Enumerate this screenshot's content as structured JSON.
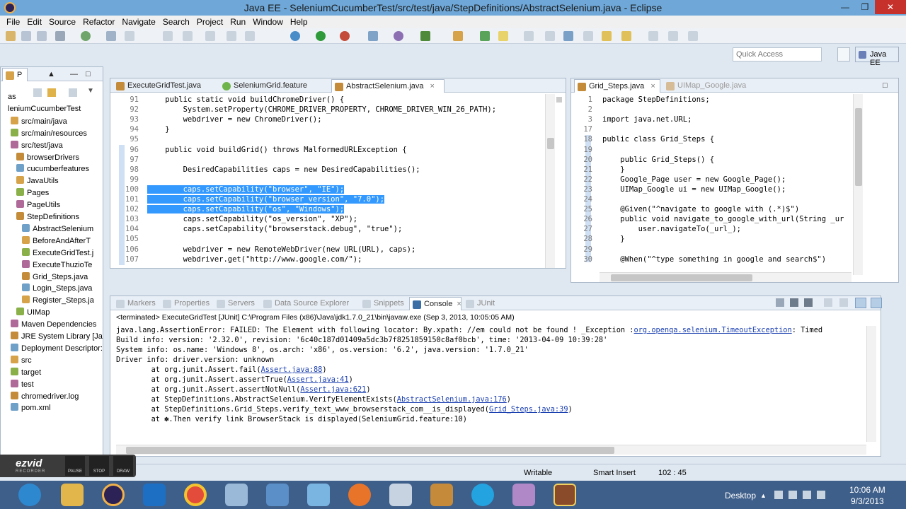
{
  "window": {
    "title": "Java EE - SeleniumCucumberTest/src/test/java/StepDefinitions/AbstractSelenium.java - Eclipse"
  },
  "menu": [
    "File",
    "Edit",
    "Source",
    "Refactor",
    "Navigate",
    "Search",
    "Project",
    "Run",
    "Window",
    "Help"
  ],
  "quick_access": {
    "placeholder": "Quick Access"
  },
  "perspective": {
    "label": "Java EE"
  },
  "package_explorer": {
    "tab_label": "P",
    "items": [
      {
        "label": "as",
        "indent": 0
      },
      {
        "label": "leniumCucumberTest",
        "indent": 0
      },
      {
        "label": "src/main/java",
        "indent": 1
      },
      {
        "label": "src/main/resources",
        "indent": 1
      },
      {
        "label": "src/test/java",
        "indent": 1
      },
      {
        "label": "browserDrivers",
        "indent": 2
      },
      {
        "label": "cucumberfeatures",
        "indent": 2
      },
      {
        "label": "JavaUtils",
        "indent": 2
      },
      {
        "label": "Pages",
        "indent": 2
      },
      {
        "label": "PageUtils",
        "indent": 2
      },
      {
        "label": "StepDefinitions",
        "indent": 2
      },
      {
        "label": "AbstractSelenium",
        "indent": 3
      },
      {
        "label": "BeforeAndAfterT",
        "indent": 3
      },
      {
        "label": "ExecuteGridTest.j",
        "indent": 3
      },
      {
        "label": "ExecuteThuzioTe",
        "indent": 3
      },
      {
        "label": "Grid_Steps.java",
        "indent": 3
      },
      {
        "label": "Login_Steps.java",
        "indent": 3
      },
      {
        "label": "Register_Steps.ja",
        "indent": 3
      },
      {
        "label": "UIMap",
        "indent": 2
      },
      {
        "label": "Maven Dependencies",
        "indent": 1
      },
      {
        "label": "JRE System Library [JavaS",
        "indent": 1
      },
      {
        "label": "Deployment Descriptor:",
        "indent": 1
      },
      {
        "label": "src",
        "indent": 1
      },
      {
        "label": "target",
        "indent": 1
      },
      {
        "label": "test",
        "indent": 1
      },
      {
        "label": "chromedriver.log",
        "indent": 1
      },
      {
        "label": "pom.xml",
        "indent": 1
      }
    ]
  },
  "editor_left": {
    "tabs": [
      {
        "label": "ExecuteGridTest.java",
        "active": false
      },
      {
        "label": "SeleniumGrid.feature",
        "active": false
      },
      {
        "label": "AbstractSelenium.java",
        "active": true
      }
    ],
    "lines": [
      {
        "n": "91",
        "text": "    public static void buildChromeDriver() {"
      },
      {
        "n": "92",
        "text": "        System.setProperty(CHROME_DRIVER_PROPERTY, CHROME_DRIVER_WIN_26_PATH);"
      },
      {
        "n": "93",
        "text": "        webdriver = new ChromeDriver();"
      },
      {
        "n": "94",
        "text": "    }"
      },
      {
        "n": "95",
        "text": ""
      },
      {
        "n": "96",
        "text": "    public void buildGrid() throws MalformedURLException {"
      },
      {
        "n": "97",
        "text": ""
      },
      {
        "n": "98",
        "text": "        DesiredCapabilities caps = new DesiredCapabilities();"
      },
      {
        "n": "99",
        "text": ""
      },
      {
        "n": "100",
        "text": "        caps.setCapability(\"browser\", \"IE\");",
        "sel": true
      },
      {
        "n": "101",
        "text": "        caps.setCapability(\"browser_version\", \"7.0\");",
        "sel": true
      },
      {
        "n": "102",
        "text": "        caps.setCapability(\"os\", \"Windows\");",
        "sel": true
      },
      {
        "n": "103",
        "text": "        caps.setCapability(\"os_version\", \"XP\");"
      },
      {
        "n": "104",
        "text": "        caps.setCapability(\"browserstack.debug\", \"true\");"
      },
      {
        "n": "105",
        "text": ""
      },
      {
        "n": "106",
        "text": "        webdriver = new RemoteWebDriver(new URL(URL), caps);"
      },
      {
        "n": "107",
        "text": "        webdriver.get(\"http://www.google.com/\");"
      }
    ]
  },
  "editor_right": {
    "tabs": [
      {
        "label": "Grid_Steps.java",
        "active": true
      },
      {
        "label": "UIMap_Google.java",
        "active": false
      }
    ],
    "lines": [
      {
        "n": "1",
        "text": "package StepDefinitions;"
      },
      {
        "n": "2",
        "text": ""
      },
      {
        "n": "3",
        "text": "import java.net.URL;"
      },
      {
        "n": "17",
        "text": ""
      },
      {
        "n": "18",
        "text": "public class Grid_Steps {"
      },
      {
        "n": "19",
        "text": ""
      },
      {
        "n": "20",
        "text": "    public Grid_Steps() {"
      },
      {
        "n": "21",
        "text": "    }"
      },
      {
        "n": "22",
        "text": "    Google_Page user = new Google_Page();"
      },
      {
        "n": "23",
        "text": "    UIMap_Google ui = new UIMap_Google();"
      },
      {
        "n": "24",
        "text": ""
      },
      {
        "n": "25",
        "text": "    @Given(\"^navigate to google with (.*)$\")"
      },
      {
        "n": "26",
        "text": "    public void navigate_to_google_with_url(String _ur"
      },
      {
        "n": "27",
        "text": "        user.navigateTo(_url_);"
      },
      {
        "n": "28",
        "text": "    }"
      },
      {
        "n": "29",
        "text": ""
      },
      {
        "n": "30",
        "text": "    @When(\"^type something in google and search$\")"
      }
    ]
  },
  "bottom_panel": {
    "tabs": [
      "Markers",
      "Properties",
      "Servers",
      "Data Source Explorer",
      "Snippets",
      "Console",
      "JUnit"
    ],
    "active_tab": "Console",
    "terminated": "<terminated> ExecuteGridTest [JUnit] C:\\Program Files (x86)\\Java\\jdk1.7.0_21\\bin\\javaw.exe (Sep 3, 2013, 10:05:05 AM)",
    "lines": [
      {
        "pre": "java.lang.AssertionError: FAILED: The Element with following locator: By.xpath: //em could not be found ! _Exception :",
        "link": "org.openqa.selenium.TimeoutException",
        "post": ": Timed"
      },
      {
        "pre": "Build info: version: '2.32.0', revision: '6c40c187d01409a5dc3b7f8251859150c8af0bcb', time: '2013-04-09 10:39:28'",
        "link": "",
        "post": ""
      },
      {
        "pre": "System info: os.name: 'Windows 8', os.arch: 'x86', os.version: '6.2', java.version: '1.7.0_21'",
        "link": "",
        "post": ""
      },
      {
        "pre": "Driver info: driver.version: unknown",
        "link": "",
        "post": ""
      },
      {
        "pre": "        at org.junit.Assert.fail(",
        "link": "Assert.java:88",
        "post": ")"
      },
      {
        "pre": "        at org.junit.Assert.assertTrue(",
        "link": "Assert.java:41",
        "post": ")"
      },
      {
        "pre": "        at org.junit.Assert.assertNotNull(",
        "link": "Assert.java:621",
        "post": ")"
      },
      {
        "pre": "        at StepDefinitions.AbstractSelenium.VerifyElementExists(",
        "link": "AbstractSelenium.java:176",
        "post": ")"
      },
      {
        "pre": "        at StepDefinitions.Grid_Steps.verify_text_www_browserstack_com__is_displayed(",
        "link": "Grid_Steps.java:39",
        "post": ")"
      },
      {
        "pre": "        at ✽.Then verify link BrowserStack is displayed(SeleniumGrid.feature:10)",
        "link": "",
        "post": ""
      }
    ]
  },
  "status": {
    "writable": "Writable",
    "insert_mode": "Smart Insert",
    "position": "102 : 45"
  },
  "recorder": {
    "brand": "ezvid",
    "sub": "RECORDER",
    "buttons": [
      "PAUSE",
      "STOP",
      "DRAW"
    ]
  },
  "tray": {
    "desktop": "Desktop",
    "time": "10:06 AM",
    "date": "9/3/2013"
  }
}
